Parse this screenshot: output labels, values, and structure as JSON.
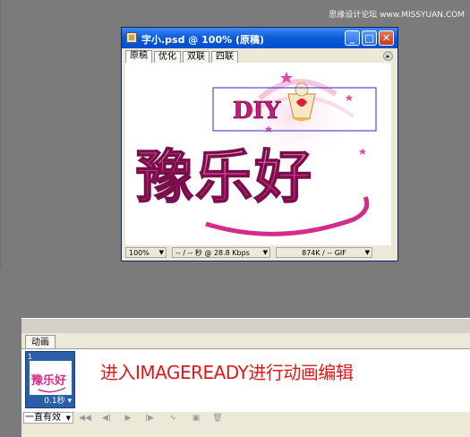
{
  "watermark": "思缘设计论坛 www.MISSYUAN.COM",
  "window": {
    "title": "字小.psd @ 100% (原稿)",
    "controls": {
      "minimize": "_",
      "maximize": "□",
      "close": "✕"
    },
    "tabs": [
      {
        "label": "原稿",
        "active": true
      },
      {
        "label": "优化",
        "active": false
      },
      {
        "label": "双联",
        "active": false
      },
      {
        "label": "四联",
        "active": false
      }
    ],
    "artwork_logo_text": "豫乐好",
    "artwork_diy_text": "DIY",
    "status": {
      "zoom": "100%",
      "download": "-- / -- 秒 @ 28.8 Kbps",
      "size": "874K / -- GIF"
    }
  },
  "animation": {
    "tab_label": "动画",
    "frames": [
      {
        "number": "1",
        "delay": "0.1秒"
      }
    ],
    "loop_option": "一直有效",
    "caption": "进入IMAGEREADY进行动画编辑"
  },
  "colors": {
    "accent_pink": "#d42c8a",
    "caption_red": "#e01818",
    "title_blue": "#0a5ad8"
  }
}
